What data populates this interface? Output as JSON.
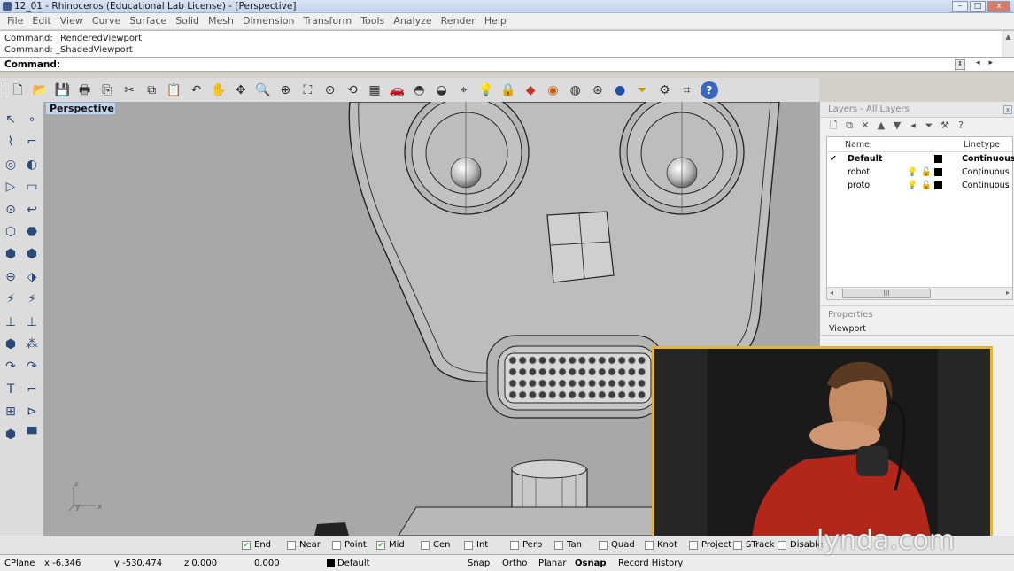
{
  "window": {
    "title": "12_01 - Rhinoceros (Educational Lab License) - [Perspective]",
    "buttons": [
      "–",
      "□",
      "x"
    ]
  },
  "menu": [
    "File",
    "Edit",
    "View",
    "Curve",
    "Surface",
    "Solid",
    "Mesh",
    "Dimension",
    "Transform",
    "Tools",
    "Analyze",
    "Render",
    "Help"
  ],
  "command_history": [
    "Command: _RenderedViewport",
    "Command: _ShadedViewport"
  ],
  "command_prompt": "Command:",
  "toolbar_icons": [
    "new-icon",
    "open-icon",
    "save-icon",
    "print-icon",
    "import-icon",
    "cut-icon",
    "copy-icon",
    "paste-icon",
    "undo-icon",
    "pan-icon",
    "rotate-view-icon",
    "zoom-icon",
    "zoom-window-icon",
    "zoom-extents-icon",
    "zoom-selected-icon",
    "rotate-icon",
    "viewports-icon",
    "car-icon",
    "hide-icon",
    "show-icon",
    "select-points-icon",
    "light-icon",
    "lock-icon",
    "layer-icon",
    "color-wheel-icon",
    "sphere-shaded-icon",
    "sphere-wire-icon",
    "sphere-rendered-icon",
    "filter-icon",
    "gear-icon",
    "snap-icon",
    "help-icon"
  ],
  "toolbar_glyphs": [
    "🗋",
    "📂",
    "💾",
    "🖶",
    "⎘",
    "✂",
    "⧉",
    "📋",
    "↶",
    "✋",
    "✥",
    "🔍",
    "⊕",
    "⛶",
    "⊙",
    "⟲",
    "▦",
    "🚗",
    "◓",
    "◒",
    "⌖",
    "💡",
    "🔒",
    "◆",
    "◉",
    "◍",
    "⊛",
    "●",
    "⏷",
    "⚙",
    "⌗",
    "?"
  ],
  "left_toolbar_glyphs": [
    "↖",
    "∘",
    "⌇",
    "⌐",
    "◎",
    "◐",
    "▷",
    "▭",
    "⊙",
    "↩",
    "⬡",
    "⬣",
    "⬢",
    "⬢",
    "⊖",
    "⬗",
    "⚡",
    "⚡",
    "⊥",
    "⊥",
    "⬢",
    "⁂",
    "↷",
    "↷",
    "T",
    "⌐",
    "⊞",
    "⊳",
    "⬢",
    "▀"
  ],
  "viewport": {
    "label": "Perspective",
    "axes": {
      "z": "z",
      "y": "y",
      "x": "x"
    }
  },
  "layers_panel": {
    "title": "Layers - All Layers",
    "tools": [
      "🗋",
      "⧉",
      "✕",
      "▲",
      "▼",
      "◂",
      "⏷",
      "⚒",
      "?"
    ],
    "columns": {
      "name": "Name",
      "linetype": "Linetype"
    },
    "rows": [
      {
        "current": "✔",
        "name": "Default",
        "linetype": "Continuous",
        "color": "#000000"
      },
      {
        "current": "",
        "name": "robot",
        "linetype": "Continuous",
        "color": "#000000"
      },
      {
        "current": "",
        "name": "proto",
        "linetype": "Continuous",
        "color": "#000000"
      }
    ],
    "scroll_left": "◂",
    "scroll_thumb": "III",
    "scroll_right": "▸"
  },
  "properties_panel": {
    "title": "Properties",
    "section": "Viewport"
  },
  "osnaps": [
    {
      "label": "End",
      "checked": true
    },
    {
      "label": "Near",
      "checked": false
    },
    {
      "label": "Point",
      "checked": false
    },
    {
      "label": "Mid",
      "checked": true
    },
    {
      "label": "Cen",
      "checked": false
    },
    {
      "label": "Int",
      "checked": false
    },
    {
      "label": "Perp",
      "checked": false
    },
    {
      "label": "Tan",
      "checked": false
    },
    {
      "label": "Quad",
      "checked": false
    },
    {
      "label": "Knot",
      "checked": false
    },
    {
      "label": "Project",
      "checked": false
    },
    {
      "label": "STrack",
      "checked": false
    },
    {
      "label": "Disable",
      "checked": false
    }
  ],
  "status": {
    "cplane": "CPlane",
    "x": "x -6.346",
    "y": "y -530.474",
    "z": "z 0.000",
    "dist": "0.000",
    "layer": "Default",
    "snap": "Snap",
    "ortho": "Ortho",
    "planar": "Planar",
    "osnap": "Osnap",
    "record_history": "Record History"
  },
  "watermark": "lynda.com",
  "colors": {
    "accent_frame": "#e5b33a",
    "viewport_bg": "#a8a8a8"
  }
}
